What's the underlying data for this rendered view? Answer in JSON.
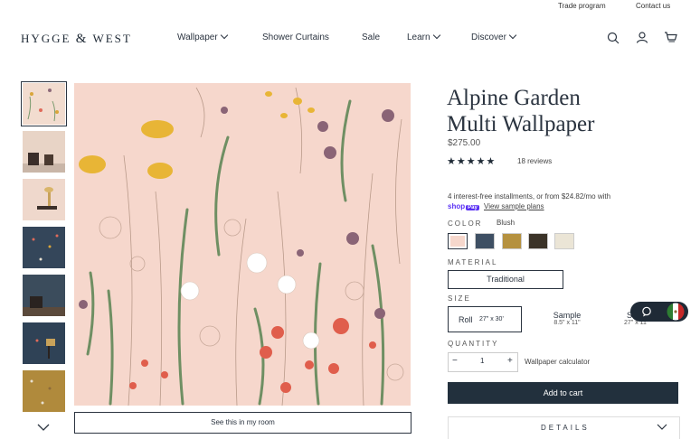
{
  "utility": {
    "trade": "Trade program",
    "contact": "Contact us"
  },
  "logo": {
    "left": "HYGGE",
    "amp": "&",
    "right": "WEST"
  },
  "nav": [
    {
      "label": "Wallpaper",
      "dropdown": true
    },
    {
      "label": "Shower Curtains",
      "dropdown": false
    },
    {
      "label": "Sale",
      "dropdown": false
    },
    {
      "label": "Learn",
      "dropdown": true
    },
    {
      "label": "Discover",
      "dropdown": true
    }
  ],
  "icons": [
    "search-icon",
    "account-icon",
    "cart-icon"
  ],
  "gallery": {
    "see_in_room": "See this in my room",
    "thumbnail_colors": [
      "#f2dccf",
      "#e8d4c6",
      "#efd8cc",
      "#34465a",
      "#3b4c5c",
      "#2f4256",
      "#b08a3c"
    ]
  },
  "product": {
    "title_line1": "Alpine Garden",
    "title_line2": "Multi Wallpaper",
    "price": "$275.00",
    "stars": "★★★★★",
    "reviews": "18 reviews",
    "installments": "4 interest-free installments, or from $24.82/mo with",
    "shop_pay": "shop",
    "shop_pay_badge": "Pay",
    "sample_plans": "View sample plans"
  },
  "color": {
    "label": "COLOR",
    "selected": "Blush",
    "swatches": [
      "#f6d7cc",
      "#3e4f63",
      "#b5913f",
      "#3b3328",
      "#ebe5d6"
    ]
  },
  "material": {
    "label": "MATERIAL",
    "option": "Traditional"
  },
  "size": {
    "label": "SIZE",
    "options": [
      {
        "name": "Roll",
        "dim": "27\" x 30'"
      },
      {
        "name": "Sample",
        "dim": "8.5\" x 11\""
      },
      {
        "name": "S",
        "dim": "27\" x 11\""
      }
    ]
  },
  "quantity": {
    "label": "QUANTITY",
    "value": "1",
    "minus": "−",
    "plus": "+",
    "calculator": "Wallpaper calculator"
  },
  "add_to_cart": "Add to cart",
  "details": "DETAILS",
  "chat": {
    "flag_colors": [
      "#2e7d32",
      "#ffffff",
      "#c62828"
    ]
  }
}
